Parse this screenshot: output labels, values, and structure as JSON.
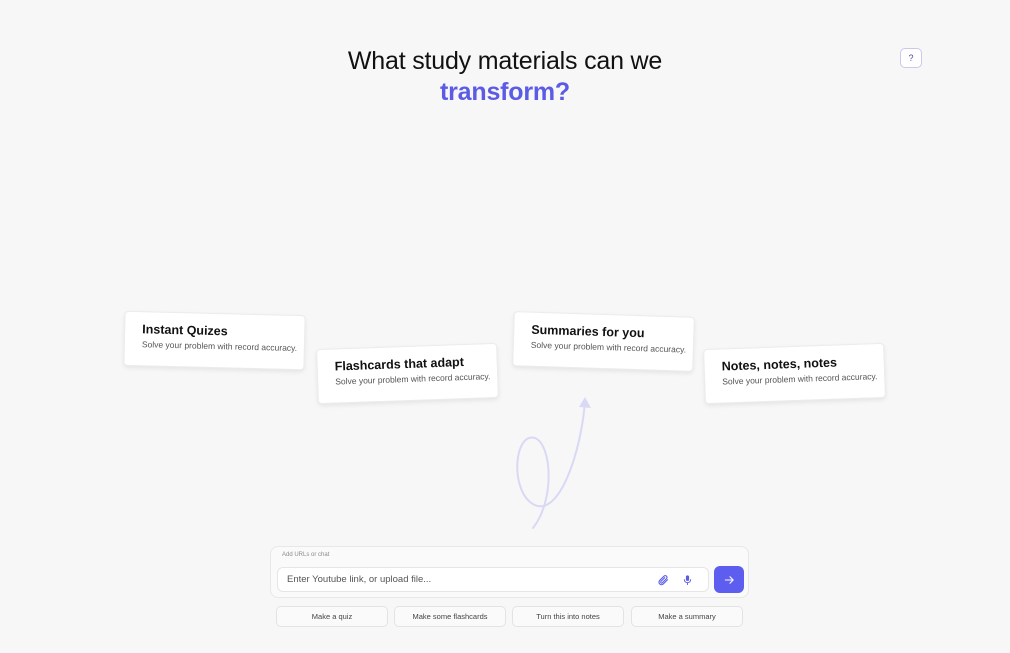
{
  "header": {
    "title_line1": "What study materials can we",
    "title_accent": "transform?",
    "help_label": "?"
  },
  "features": [
    {
      "title": "Instant Quizes",
      "desc": "Solve your problem with record accuracy."
    },
    {
      "title": "Flashcards that adapt",
      "desc": "Solve your problem with record accuracy."
    },
    {
      "title": "Summaries for you",
      "desc": "Solve your problem with record accuracy."
    },
    {
      "title": "Notes, notes, notes",
      "desc": "Solve your problem with record accuracy."
    }
  ],
  "chat": {
    "label": "Add URLs or chat",
    "placeholder": "Enter Youtube link, or upload file...",
    "value": ""
  },
  "chips": [
    {
      "label": "Make a quiz"
    },
    {
      "label": "Make some flashcards"
    },
    {
      "label": "Turn this into notes"
    },
    {
      "label": "Make a summary"
    }
  ],
  "icons": {
    "attach": "paperclip-icon",
    "mic": "microphone-icon",
    "send": "arrow-right-icon",
    "decor_arrow": "curly-arrow-icon"
  },
  "colors": {
    "accent": "#5b5be6",
    "send_button": "#5d5df0",
    "arrow_stroke": "#d9d9f5",
    "background": "#f7f7f7"
  }
}
